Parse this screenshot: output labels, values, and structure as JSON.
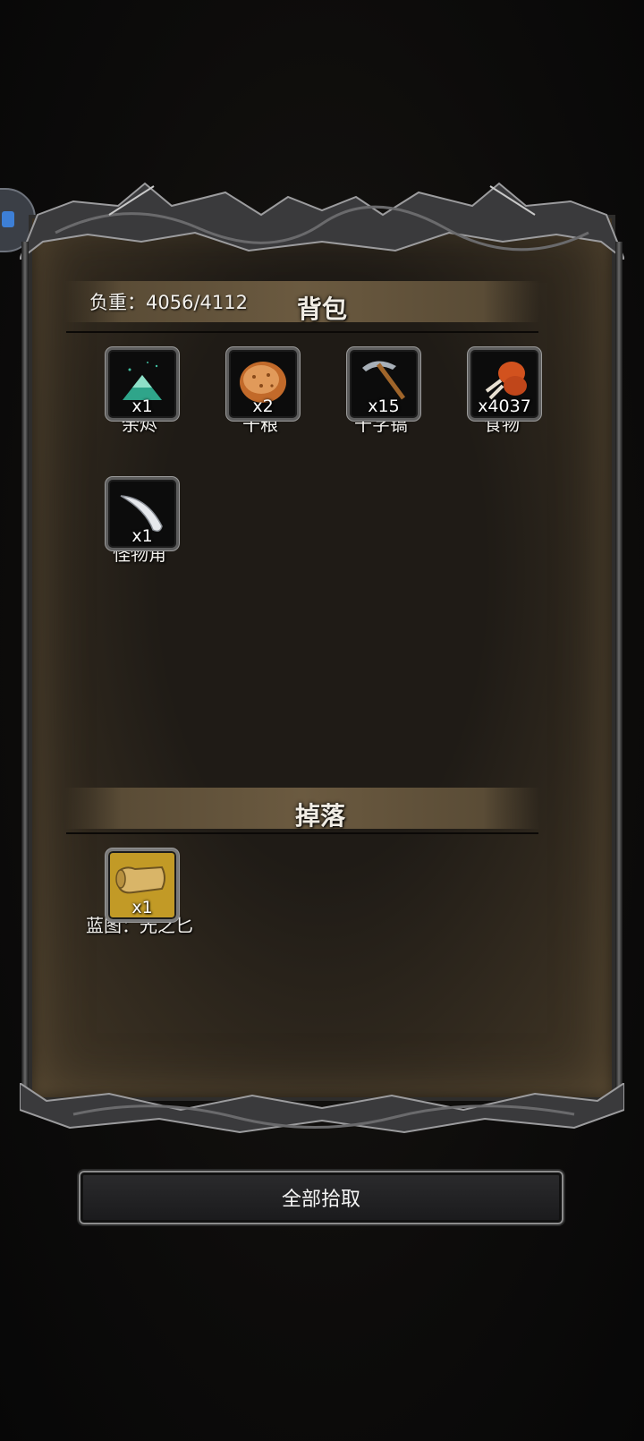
{
  "backpack": {
    "title": "背包",
    "weight_label": "负重：4056/4112",
    "items": [
      {
        "name": "余烬",
        "qty": "x1",
        "icon": "ember-icon"
      },
      {
        "name": "干粮",
        "qty": "x2",
        "icon": "ration-icon"
      },
      {
        "name": "十字镐",
        "qty": "x15",
        "icon": "pickaxe-icon"
      },
      {
        "name": "食物",
        "qty": "x4037",
        "icon": "meat-icon"
      },
      {
        "name": "怪物角",
        "qty": "x1",
        "icon": "monster-horn-icon"
      }
    ]
  },
  "drops": {
    "title": "掉落",
    "items": [
      {
        "name": "蓝图：光之匕",
        "qty": "x1",
        "icon": "blueprint-scroll-icon"
      }
    ]
  },
  "actions": {
    "pickup_all_label": "全部拾取"
  },
  "colors": {
    "panel_bg": "#1f1b16",
    "header_band": "#6b5a40",
    "drop_slot_gold": "#c29a26"
  }
}
